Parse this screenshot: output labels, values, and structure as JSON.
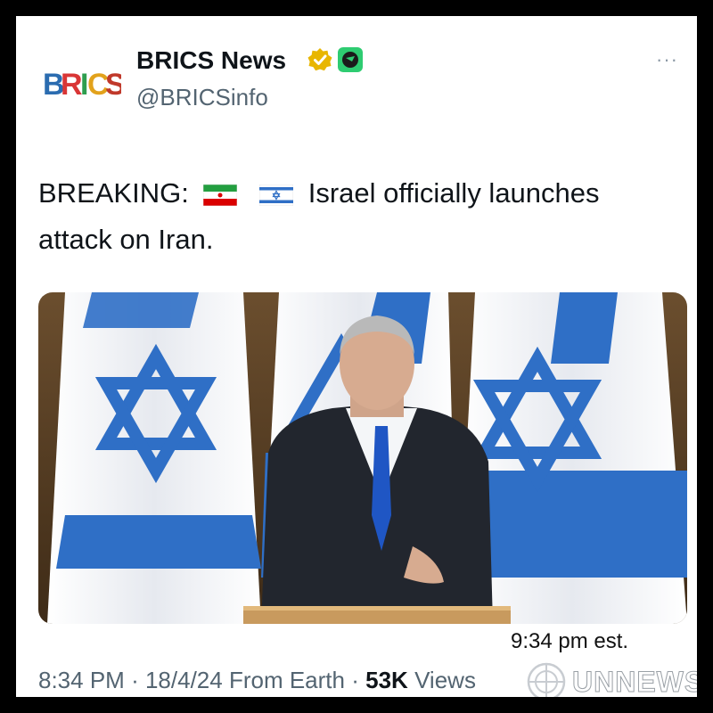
{
  "post": {
    "author": {
      "name": "BRICS News",
      "handle": "@BRICSinfo",
      "avatar_logo_text": "BRICS",
      "verified_badge_color": "#e8b600",
      "affiliate_badge_color": "#2ecc71"
    },
    "more_label": "···",
    "text": {
      "prefix": "BREAKING:",
      "flags": [
        "iran-flag-icon",
        "israel-flag-icon"
      ],
      "body": "Israel officially launches attack on Iran."
    },
    "media": {
      "description_icon": "press-conference-photo",
      "overlay_note": "9:34 pm est."
    },
    "meta": {
      "time": "8:34 PM",
      "separator": "·",
      "date": "18/4/24",
      "location": "From Earth",
      "views_count": "53K",
      "views_label": "Views"
    }
  },
  "watermark": {
    "text": "UNNEWS",
    "icon": "un-emblem-icon"
  },
  "colors": {
    "flag_blue": "#2f6fc6",
    "background": "#000000",
    "card": "#ffffff",
    "muted_text": "#536471"
  }
}
